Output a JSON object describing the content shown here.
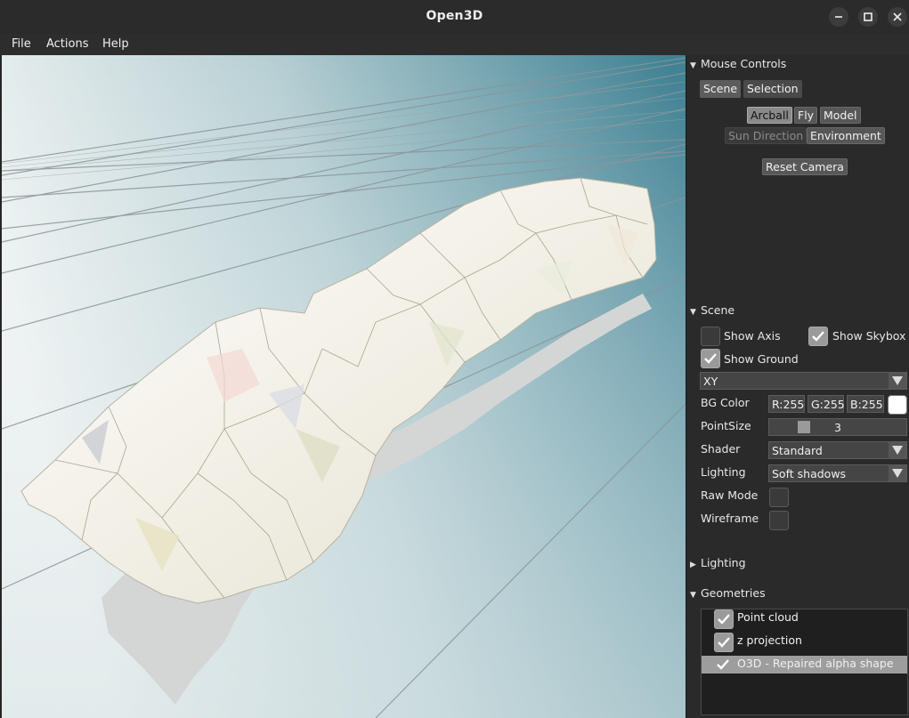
{
  "window": {
    "title": "Open3D"
  },
  "menubar": {
    "items": [
      "File",
      "Actions",
      "Help"
    ]
  },
  "panel": {
    "mouse_controls": {
      "header": "Mouse Controls",
      "tabs": [
        "Scene",
        "Selection"
      ],
      "modes": [
        "Arcball",
        "Fly",
        "Model"
      ],
      "modes2": [
        "Sun Direction",
        "Environment"
      ],
      "reset": "Reset Camera"
    },
    "scene": {
      "header": "Scene",
      "show_axis": "Show Axis",
      "show_skybox": "Show Skybox",
      "show_ground": "Show Ground",
      "ground_plane": "XY",
      "bg_color_label": "BG Color",
      "bg_r": "R:255",
      "bg_g": "G:255",
      "bg_b": "B:255",
      "bg_swatch": "#ffffff",
      "point_size_label": "PointSize",
      "point_size": "3",
      "point_size_value": 3,
      "shader_label": "Shader",
      "shader": "Standard",
      "lighting_label": "Lighting",
      "lighting": "Soft shadows",
      "raw_mode": "Raw Mode",
      "wireframe": "Wireframe"
    },
    "lighting": {
      "header": "Lighting"
    },
    "geometries": {
      "header": "Geometries",
      "items": [
        "Point cloud",
        "z projection",
        "O3D - Repaired alpha shape"
      ]
    }
  }
}
